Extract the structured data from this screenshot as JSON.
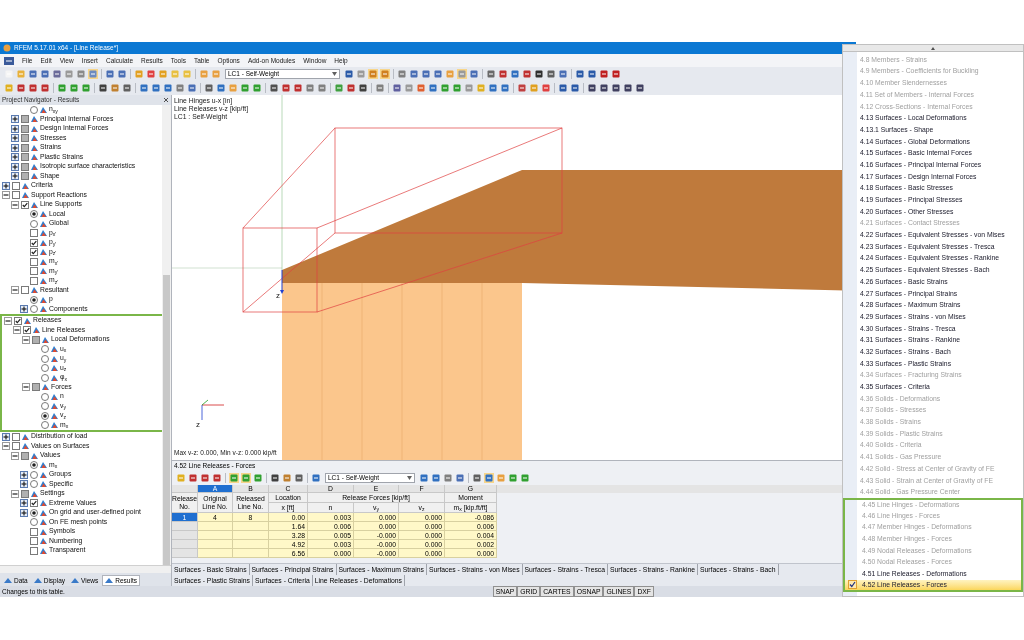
{
  "window": {
    "title": "RFEM 5.17.01 x64 - [Line Release*]"
  },
  "menu_bar": [
    "File",
    "Edit",
    "View",
    "Insert",
    "Calculate",
    "Results",
    "Tools",
    "Table",
    "Options",
    "Add-on Modules",
    "Window",
    "Help"
  ],
  "toolbar": {
    "load_case": "LC1 - Self-Weight"
  },
  "navigator": {
    "title": "Project Navigator - Results",
    "tree": [
      {
        "children": [
          {
            "children": [
              {
                "label": "n$_{xy}$",
                "kind": "radio",
                "selected": false
              }
            ]
          },
          {
            "label": "Principal Internal Forces",
            "kind": "checkbox",
            "checked": false,
            "mixed": true,
            "expanded": false
          },
          {
            "label": "Design Internal Forces",
            "kind": "checkbox",
            "checked": false,
            "mixed": true,
            "expanded": false
          },
          {
            "label": "Stresses",
            "kind": "checkbox",
            "checked": false,
            "mixed": true,
            "expanded": false
          },
          {
            "label": "Strains",
            "kind": "checkbox",
            "checked": false,
            "mixed": true,
            "expanded": false
          },
          {
            "label": "Plastic Strains",
            "kind": "checkbox",
            "checked": false,
            "mixed": true,
            "expanded": false
          },
          {
            "label": "Isotropic surface characteristics",
            "kind": "checkbox",
            "checked": false,
            "mixed": true,
            "expanded": false
          },
          {
            "label": "Shape",
            "kind": "checkbox",
            "checked": false,
            "mixed": true,
            "expanded": false
          }
        ]
      },
      {
        "label": "Criteria",
        "kind": "checkbox",
        "checked": false,
        "mixed": false,
        "expanded": false
      },
      {
        "label": "Support Reactions",
        "kind": "checkbox",
        "checked": false,
        "mixed": false,
        "expanded": true,
        "children": [
          {
            "label": "Line Supports",
            "kind": "checkbox",
            "checked": true,
            "mixed": false,
            "expanded": true,
            "children": [
              {
                "label": "Local",
                "kind": "radio",
                "selected": true
              },
              {
                "label": "Global",
                "kind": "radio",
                "selected": false
              },
              {
                "label": "p$_{x'}$",
                "kind": "checkbox",
                "checked": false,
                "mixed": false
              },
              {
                "label": "p$_{y'}$",
                "kind": "checkbox",
                "checked": true,
                "mixed": false
              },
              {
                "label": "p$_{z'}$",
                "kind": "checkbox",
                "checked": true,
                "mixed": false
              },
              {
                "label": "m$_{x'}$",
                "kind": "checkbox",
                "checked": false,
                "mixed": false
              },
              {
                "label": "m$_{y'}$",
                "kind": "checkbox",
                "checked": false,
                "mixed": false
              },
              {
                "label": "m$_{z'}$",
                "kind": "checkbox",
                "checked": false,
                "mixed": false
              }
            ]
          },
          {
            "label": "Resultant",
            "kind": "checkbox",
            "checked": false,
            "mixed": false,
            "expanded": true,
            "children": [
              {
                "label": "p",
                "kind": "radio",
                "selected": true
              },
              {
                "label": "Components",
                "kind": "radio",
                "selected": false,
                "expanded": false
              }
            ]
          }
        ]
      },
      {
        "label": "Releases",
        "kind": "checkbox",
        "checked": true,
        "mixed": false,
        "expanded": true,
        "framed": true,
        "children": [
          {
            "label": "Line Releases",
            "kind": "checkbox",
            "checked": true,
            "mixed": false,
            "expanded": true,
            "children": [
              {
                "label": "Local Deformations",
                "kind": "checkbox",
                "checked": false,
                "mixed": true,
                "expanded": true,
                "children": [
                  {
                    "label": "u$_{x}$",
                    "kind": "radio",
                    "selected": false
                  },
                  {
                    "label": "u$_{y}$",
                    "kind": "radio",
                    "selected": false
                  },
                  {
                    "label": "u$_{z}$",
                    "kind": "radio",
                    "selected": false
                  },
                  {
                    "label": "φ$_{x}$",
                    "kind": "radio",
                    "selected": false
                  }
                ]
              },
              {
                "label": "Forces",
                "kind": "checkbox",
                "checked": false,
                "mixed": true,
                "expanded": true,
                "children": [
                  {
                    "label": "n",
                    "kind": "radio",
                    "selected": false
                  },
                  {
                    "label": "v$_{y}$",
                    "kind": "radio",
                    "selected": false
                  },
                  {
                    "label": "v$_{z}$",
                    "kind": "radio",
                    "selected": true
                  },
                  {
                    "label": "m$_{x}$",
                    "kind": "radio",
                    "selected": false
                  }
                ]
              }
            ]
          }
        ]
      },
      {
        "label": "Distribution of load",
        "kind": "checkbox",
        "checked": false,
        "mixed": false,
        "expanded": false
      },
      {
        "label": "Values on Surfaces",
        "kind": "checkbox",
        "checked": false,
        "mixed": false,
        "expanded": true,
        "children": [
          {
            "label": "Values",
            "kind": "checkbox",
            "checked": false,
            "mixed": true,
            "expanded": true,
            "children": [
              {
                "label": "m$_{x}$",
                "kind": "radio",
                "selected": true
              },
              {
                "label": "Groups",
                "kind": "radio",
                "selected": false,
                "expanded": false
              },
              {
                "label": "Specific",
                "kind": "radio",
                "selected": false,
                "expanded": false
              }
            ]
          },
          {
            "label": "Settings",
            "kind": "checkbox",
            "checked": false,
            "mixed": true,
            "expanded": true,
            "children": [
              {
                "label": "Extreme Values",
                "kind": "checkbox",
                "checked": true,
                "mixed": false,
                "expanded": false
              },
              {
                "label": "On grid and user-defined point",
                "kind": "radio",
                "selected": true,
                "expanded": false
              },
              {
                "label": "On FE mesh points",
                "kind": "radio",
                "selected": false
              },
              {
                "label": "Symbols",
                "kind": "checkbox",
                "checked": false,
                "mixed": false
              },
              {
                "label": "Numbering",
                "kind": "checkbox",
                "checked": false,
                "mixed": false
              },
              {
                "label": "Transparent",
                "kind": "checkbox",
                "checked": false,
                "mixed": false
              }
            ]
          }
        ]
      }
    ],
    "tabs": [
      {
        "label": "Data",
        "selected": false
      },
      {
        "label": "Display",
        "selected": false
      },
      {
        "label": "Views",
        "selected": false
      },
      {
        "label": "Results",
        "selected": true
      }
    ]
  },
  "view": {
    "info": [
      "Line Hinges u-x [in]",
      "Line Releases v-z [kip/ft]",
      "LC1 : Self-Weight"
    ],
    "axis_labels": [
      "z",
      "z"
    ],
    "summary": "Max v-z: 0.000, Min v-z: 0.000 kip/ft"
  },
  "table": {
    "title": "4.52 Line Releases - Forces",
    "load_case": "LC1 - Self-Weight",
    "columns": [
      {
        "title": "Release No."
      },
      {
        "letter": "A",
        "title": "Original Line No.",
        "selected": true
      },
      {
        "letter": "B",
        "title": "Released Line No.",
        "selected": false
      },
      {
        "letter": "C",
        "title": "Location",
        "unit": "x [ft]",
        "selected": false
      },
      {
        "letter": "D",
        "group": "Release Forces [kip/ft]",
        "unit": "n",
        "selected": false
      },
      {
        "letter": "E",
        "unit": "v$_{y}$",
        "selected": false
      },
      {
        "letter": "F",
        "unit": "v$_{z}$",
        "selected": false
      },
      {
        "letter": "G",
        "title": "Moment",
        "unit": "m$_{x}$ [kip.ft/ft]",
        "selected": false
      }
    ],
    "rows": [
      {
        "release": "1",
        "original": "4",
        "released": "8",
        "values": [
          "0.00",
          "0.003",
          "0.000",
          "0.000",
          "-0.086"
        ],
        "selected": true
      },
      {
        "values": [
          "1.64",
          "0.006",
          "0.000",
          "0.000",
          "0.006"
        ],
        "selected": false
      },
      {
        "values": [
          "3.28",
          "0.005",
          "-0.000",
          "0.000",
          "0.004"
        ],
        "selected": false
      },
      {
        "values": [
          "4.92",
          "0.003",
          "-0.000",
          "0.000",
          "0.002"
        ],
        "selected": false
      },
      {
        "values": [
          "6.56",
          "0.000",
          "-0.000",
          "0.000",
          "0.000"
        ],
        "selected": false
      }
    ],
    "sheet_tabs": [
      "Surfaces - Basic Strains",
      "Surfaces - Principal Strains",
      "Surfaces - Maximum Strains",
      "Surfaces - Strains - von Mises",
      "Surfaces - Strains - Tresca",
      "Surfaces - Strains - Rankine",
      "Surfaces - Strains - Bach",
      "Surfaces - Plastic Strains",
      "Surfaces - Criteria",
      "Line Releases - Defomations"
    ]
  },
  "status_bar": {
    "message": "Changes to this table.",
    "toggles": [
      "SNAP",
      "GRID",
      "CARTES",
      "OSNAP",
      "GLINES",
      "DXF"
    ]
  },
  "table_menu": [
    {
      "label": "4.8 Members - Strains",
      "disabled": true,
      "checked": false,
      "selected": false,
      "framed": false
    },
    {
      "label": "4.9 Members - Coefficients for Buckling",
      "disabled": true,
      "checked": false,
      "selected": false,
      "framed": false
    },
    {
      "label": "4.10 Member Slendernesses",
      "disabled": true,
      "checked": false,
      "selected": false,
      "framed": false
    },
    {
      "label": "4.11 Set of Members - Internal Forces",
      "disabled": true,
      "checked": false,
      "selected": false,
      "framed": false
    },
    {
      "label": "4.12 Cross-Sections - Internal Forces",
      "disabled": true,
      "checked": false,
      "selected": false,
      "framed": false
    },
    {
      "label": "4.13 Surfaces - Local Deformations",
      "disabled": false,
      "checked": false,
      "selected": false,
      "framed": false
    },
    {
      "label": "4.13.1 Surfaces - Shape",
      "disabled": false,
      "checked": false,
      "selected": false,
      "framed": false
    },
    {
      "label": "4.14 Surfaces - Global Deformations",
      "disabled": false,
      "checked": false,
      "selected": false,
      "framed": false
    },
    {
      "label": "4.15 Surfaces - Basic Internal Forces",
      "disabled": false,
      "checked": false,
      "selected": false,
      "framed": false
    },
    {
      "label": "4.16 Surfaces - Principal Internal Forces",
      "disabled": false,
      "checked": false,
      "selected": false,
      "framed": false
    },
    {
      "label": "4.17 Surfaces - Design Internal Forces",
      "disabled": false,
      "checked": false,
      "selected": false,
      "framed": false
    },
    {
      "label": "4.18 Surfaces - Basic Stresses",
      "disabled": false,
      "checked": false,
      "selected": false,
      "framed": false
    },
    {
      "label": "4.19 Surfaces - Principal Stresses",
      "disabled": false,
      "checked": false,
      "selected": false,
      "framed": false
    },
    {
      "label": "4.20 Surfaces - Other Stresses",
      "disabled": false,
      "checked": false,
      "selected": false,
      "framed": false
    },
    {
      "label": "4.21 Surfaces - Contact Stresses",
      "disabled": true,
      "checked": false,
      "selected": false,
      "framed": false
    },
    {
      "label": "4.22 Surfaces - Equivalent Stresses - von Mises",
      "disabled": false,
      "checked": false,
      "selected": false,
      "framed": false
    },
    {
      "label": "4.23 Surfaces - Equivalent Stresses - Tresca",
      "disabled": false,
      "checked": false,
      "selected": false,
      "framed": false
    },
    {
      "label": "4.24 Surfaces - Equivalent Stresses - Rankine",
      "disabled": false,
      "checked": false,
      "selected": false,
      "framed": false
    },
    {
      "label": "4.25 Surfaces - Equivalent Stresses - Bach",
      "disabled": false,
      "checked": false,
      "selected": false,
      "framed": false
    },
    {
      "label": "4.26 Surfaces - Basic Strains",
      "disabled": false,
      "checked": false,
      "selected": false,
      "framed": false
    },
    {
      "label": "4.27 Surfaces - Principal Strains",
      "disabled": false,
      "checked": false,
      "selected": false,
      "framed": false
    },
    {
      "label": "4.28 Surfaces - Maximum Strains",
      "disabled": false,
      "checked": false,
      "selected": false,
      "framed": false
    },
    {
      "label": "4.29 Surfaces - Strains - von Mises",
      "disabled": false,
      "checked": false,
      "selected": false,
      "framed": false
    },
    {
      "label": "4.30 Surfaces - Strains - Tresca",
      "disabled": false,
      "checked": false,
      "selected": false,
      "framed": false
    },
    {
      "label": "4.31 Surfaces - Strains - Rankine",
      "disabled": false,
      "checked": false,
      "selected": false,
      "framed": false
    },
    {
      "label": "4.32 Surfaces - Strains - Bach",
      "disabled": false,
      "checked": false,
      "selected": false,
      "framed": false
    },
    {
      "label": "4.33 Surfaces - Plastic Strains",
      "disabled": false,
      "checked": false,
      "selected": false,
      "framed": false
    },
    {
      "label": "4.34 Surfaces - Fracturing Strains",
      "disabled": true,
      "checked": false,
      "selected": false,
      "framed": false
    },
    {
      "label": "4.35 Surfaces - Criteria",
      "disabled": false,
      "checked": false,
      "selected": false,
      "framed": false
    },
    {
      "label": "4.36 Solids - Deformations",
      "disabled": true,
      "checked": false,
      "selected": false,
      "framed": false
    },
    {
      "label": "4.37 Solids - Stresses",
      "disabled": true,
      "checked": false,
      "selected": false,
      "framed": false
    },
    {
      "label": "4.38 Solids - Strains",
      "disabled": true,
      "checked": false,
      "selected": false,
      "framed": false
    },
    {
      "label": "4.39 Solids - Plastic Strains",
      "disabled": true,
      "checked": false,
      "selected": false,
      "framed": false
    },
    {
      "label": "4.40 Solids - Criteria",
      "disabled": true,
      "checked": false,
      "selected": false,
      "framed": false
    },
    {
      "label": "4.41 Solids - Gas Pressure",
      "disabled": true,
      "checked": false,
      "selected": false,
      "framed": false
    },
    {
      "label": "4.42 Solid - Stress at Center of Gravity of FE",
      "disabled": true,
      "checked": false,
      "selected": false,
      "framed": false
    },
    {
      "label": "4.43 Solid - Strain at Center of Gravity of FE",
      "disabled": true,
      "checked": false,
      "selected": false,
      "framed": false
    },
    {
      "label": "4.44 Solid - Gas Pressure Center",
      "disabled": true,
      "checked": false,
      "selected": false,
      "framed": false
    },
    {
      "label": "4.45 Line Hinges - Deformations",
      "disabled": true,
      "checked": false,
      "selected": false,
      "framed": true
    },
    {
      "label": "4.46 Line Hinges - Forces",
      "disabled": true,
      "checked": false,
      "selected": false,
      "framed": true
    },
    {
      "label": "4.47 Member Hinges - Deformations",
      "disabled": true,
      "checked": false,
      "selected": false,
      "framed": true
    },
    {
      "label": "4.48 Member Hinges - Forces",
      "disabled": true,
      "checked": false,
      "selected": false,
      "framed": true
    },
    {
      "label": "4.49 Nodal Releases - Deformations",
      "disabled": true,
      "checked": false,
      "selected": false,
      "framed": true
    },
    {
      "label": "4.50 Nodal Releases - Forces",
      "disabled": true,
      "checked": false,
      "selected": false,
      "framed": true
    },
    {
      "label": "4.51 Line Releases - Deformations",
      "disabled": false,
      "checked": false,
      "selected": false,
      "framed": true
    },
    {
      "label": "4.52 Line Releases - Forces",
      "disabled": false,
      "checked": true,
      "selected": true,
      "framed": true
    }
  ]
}
